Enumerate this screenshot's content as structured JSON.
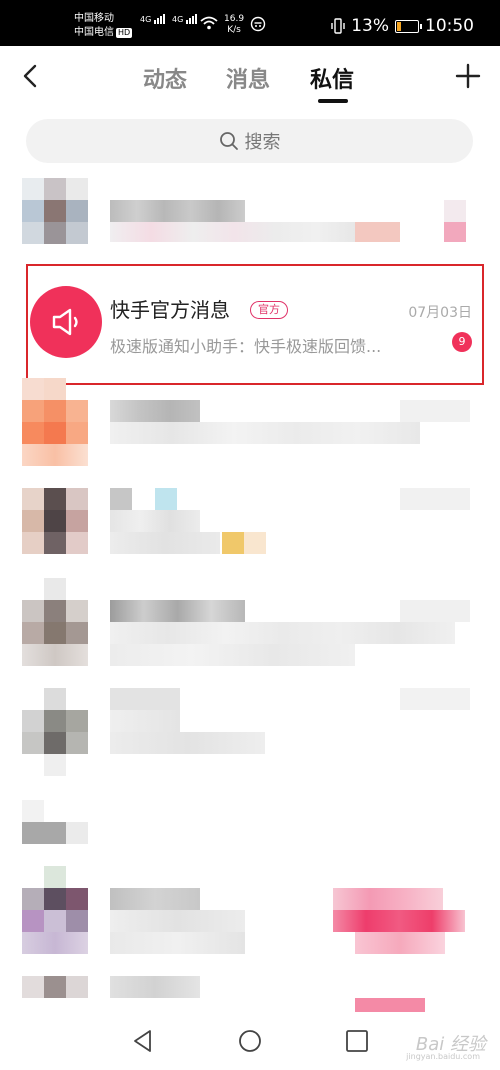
{
  "status_bar": {
    "carrier1": "中国移动",
    "carrier2": "中国电信",
    "hd": "HD",
    "network": "4G",
    "speed_value": "16.9",
    "speed_unit": "K/s",
    "battery": "13%",
    "time": "10:50"
  },
  "header": {
    "tabs": [
      {
        "label": "动态"
      },
      {
        "label": "消息"
      },
      {
        "label": "私信"
      }
    ],
    "active_tab": "私信"
  },
  "search": {
    "placeholder": "搜索"
  },
  "highlighted_conversation": {
    "title": "快手官方消息",
    "badge": "官方",
    "date": "07月03日",
    "preview": "极速版通知小助手：快手极速版回馈...",
    "unread_count": "9",
    "accent_color": "#f0315a"
  },
  "watermark": {
    "text": "Bai 经验",
    "sub": "jingyan.baidu.com"
  }
}
